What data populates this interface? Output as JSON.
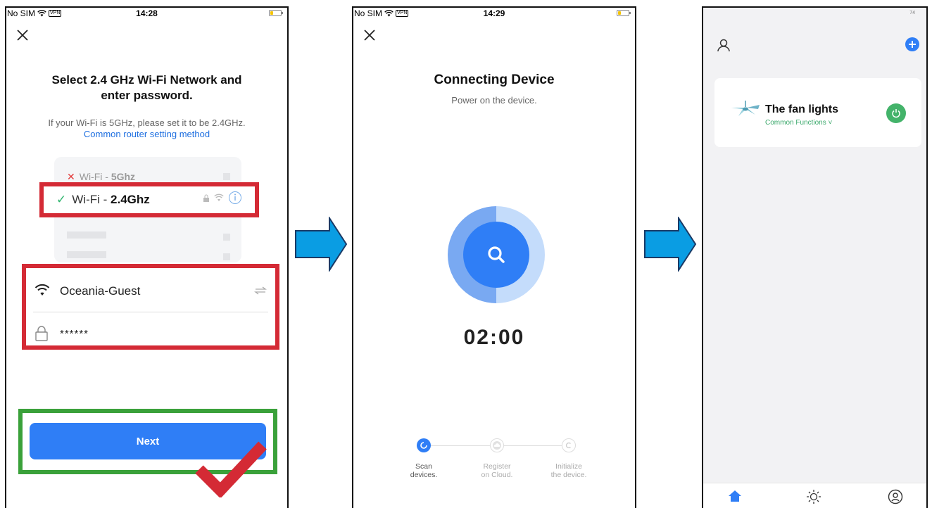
{
  "screen1": {
    "status": {
      "carrier": "No SIM",
      "vpn": "VPN",
      "time": "14:28"
    },
    "title_line1": "Select 2.4 GHz Wi-Fi Network and",
    "title_line2": "enter password.",
    "hint": "If your Wi-Fi is 5GHz, please set it to be 2.4GHz.",
    "link": "Common router setting method",
    "wifi_5g": {
      "prefix": "Wi-Fi - ",
      "band": "5Ghz"
    },
    "wifi_24g": {
      "prefix": "Wi-Fi - ",
      "band": "2.4Ghz"
    },
    "ssid": "Oceania-Guest",
    "password": "******",
    "next_label": "Next"
  },
  "screen2": {
    "status": {
      "carrier": "No SIM",
      "vpn": "VPN",
      "time": "14:29"
    },
    "title": "Connecting Device",
    "subtitle": "Power on the device.",
    "countdown": "02:00",
    "steps": [
      {
        "line1": "Scan",
        "line2": "devices."
      },
      {
        "line1": "Register",
        "line2": "on Cloud."
      },
      {
        "line1": "Initialize",
        "line2": "the device."
      }
    ]
  },
  "screen3": {
    "status_right": "74",
    "device_name": "The fan lights",
    "device_functions": "Common Functions ˅"
  },
  "colors": {
    "primary_blue": "#2f7ef6",
    "highlight_red": "#d42a35",
    "highlight_green": "#3aa13a",
    "arrow_blue": "#0a9de3",
    "power_green": "#43b36a"
  }
}
